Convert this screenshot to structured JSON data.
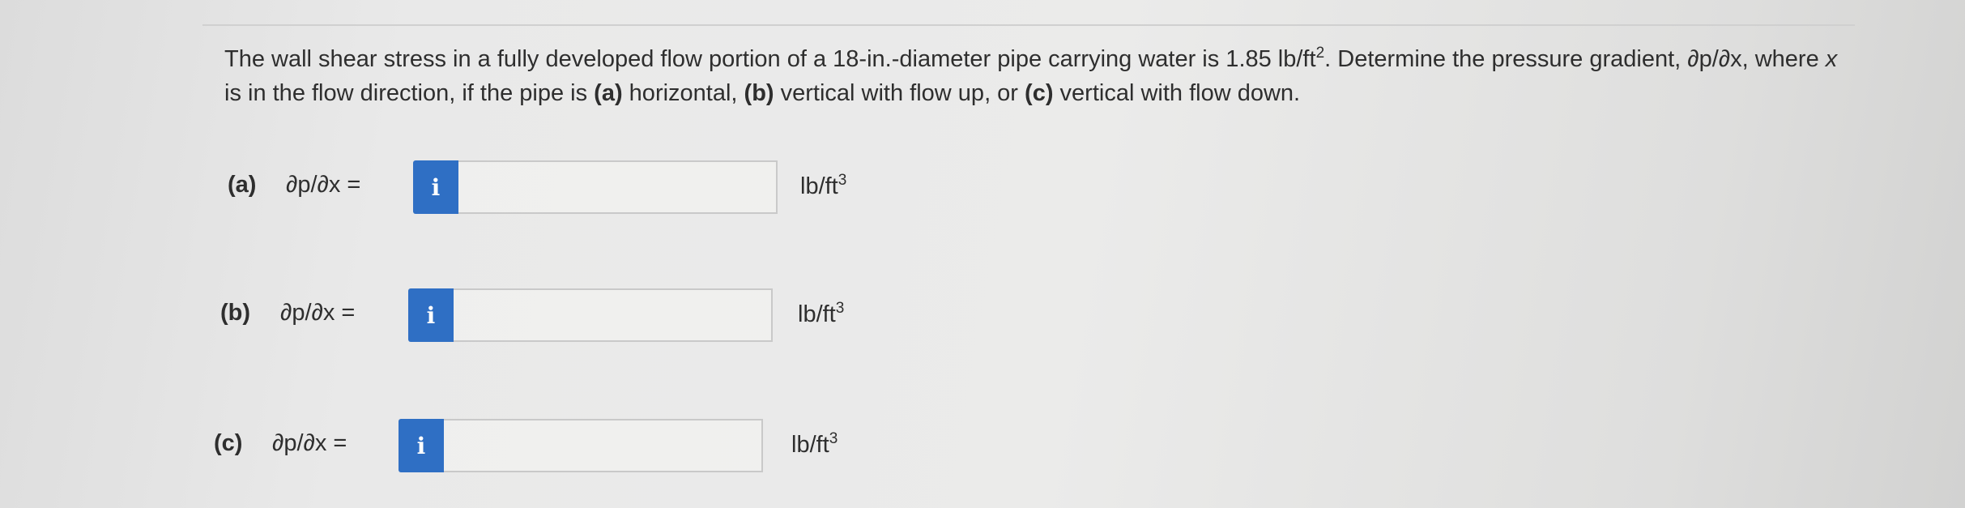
{
  "question": {
    "part1": "The wall shear stress in a fully developed flow portion of a 18-in.-diameter pipe carrying water is 1.85 lb/ft",
    "exp1": "2",
    "part2": ". Determine the pressure gradient, ∂p/∂x, where ",
    "var_x": "x",
    "part3": " is in the flow direction, if the pipe is ",
    "opt_a": "(a)",
    "text_a": " horizontal, ",
    "opt_b": "(b)",
    "text_b": " vertical with flow up, or ",
    "opt_c": "(c)",
    "text_c": " vertical with flow down."
  },
  "answers": [
    {
      "label": "(a)",
      "expression": "∂p/∂x =",
      "info_glyph": "i",
      "value": "",
      "unit": "lb/ft",
      "unit_exp": "3"
    },
    {
      "label": "(b)",
      "expression": "∂p/∂x =",
      "info_glyph": "i",
      "value": "",
      "unit": "lb/ft",
      "unit_exp": "3"
    },
    {
      "label": "(c)",
      "expression": "∂p/∂x =",
      "info_glyph": "i",
      "value": "",
      "unit": "lb/ft",
      "unit_exp": "3"
    }
  ],
  "colors": {
    "info_button": "#2f6fc4",
    "text": "#2e2e2e"
  },
  "icons": {
    "info": "info-icon"
  }
}
